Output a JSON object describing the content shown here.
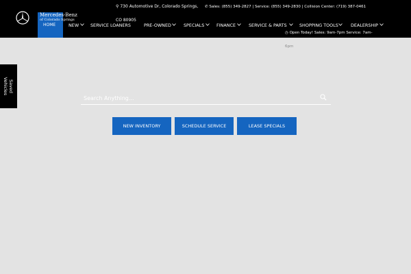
{
  "header": {
    "brand": {
      "line1": "Mercedes-Benz",
      "line2": "of Colorado Springs"
    },
    "address": {
      "line1": "730 Automotive Dr, Colorado Springs,",
      "line2": "CO 80905"
    },
    "phones": "Sales: (855) 349-2827 | Service: (855) 349-2830 | Collision Center: (719) 387-0461",
    "hours": {
      "visible": "Open Today! Sales:  9am-7pm  Service:  7am-",
      "overflow": "6pm"
    }
  },
  "nav": [
    {
      "label": "HOME"
    },
    {
      "label": "NEW"
    },
    {
      "label": "SERVICE LOANERS"
    },
    {
      "label": "PRE-OWNED"
    },
    {
      "label": "SPECIALS"
    },
    {
      "label": "FINANCE"
    },
    {
      "label": "SERVICE & PARTS"
    },
    {
      "label": "SHOPPING TOOLS"
    },
    {
      "label": "DEALERSHIP"
    }
  ],
  "saved_vehicles": {
    "line1": "Saved",
    "line2": "Vehicles"
  },
  "search": {
    "placeholder": "Search Anything..."
  },
  "cta_buttons": [
    {
      "label": "NEW INVENTORY"
    },
    {
      "label": "SCHEDULE SERVICE"
    },
    {
      "label": "LEASE SPECIALS"
    }
  ],
  "colors": {
    "accent": "#1565c0",
    "header_bg": "#000000",
    "page_bg": "#e3e3e3"
  },
  "icons": [
    "mercedes-star-icon",
    "location-pin-icon",
    "phone-icon",
    "clock-icon",
    "search-icon",
    "chevron-down-icon"
  ]
}
